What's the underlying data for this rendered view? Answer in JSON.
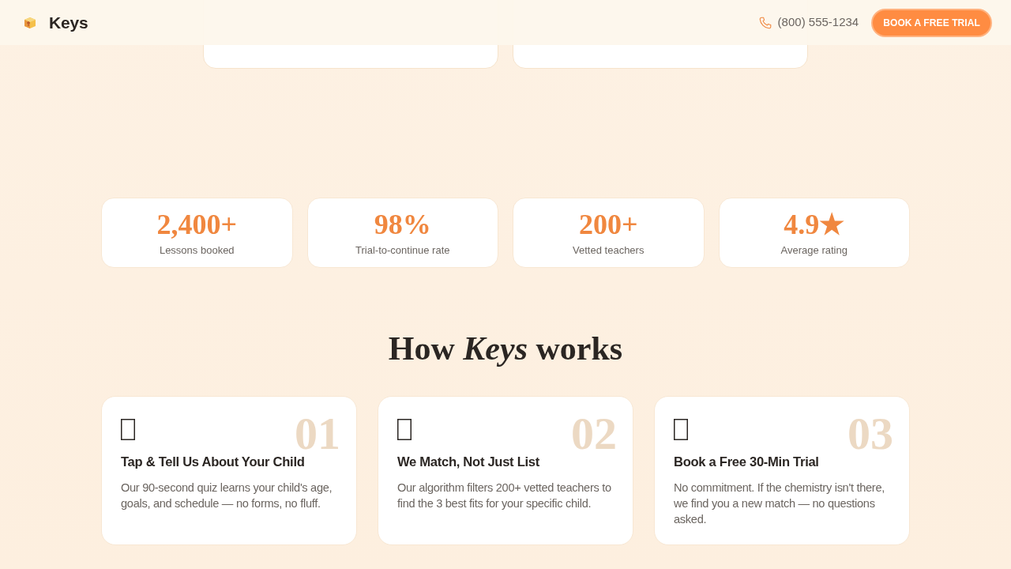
{
  "header": {
    "brand": "Keys",
    "phone": "(800) 555-1234",
    "cta": "BOOK A FREE TRIAL"
  },
  "previous_section": {
    "cards": [
      {
        "kind": "cut-off-card"
      },
      {
        "kind": "cut-off-card"
      }
    ]
  },
  "stats": [
    {
      "value": "2,400+",
      "label": "Lessons booked"
    },
    {
      "value": "98%",
      "label": "Trial-to-continue rate"
    },
    {
      "value": "200+",
      "label": "Vetted teachers"
    },
    {
      "value": "4.9★",
      "label": "Average rating"
    }
  ],
  "how_it_works": {
    "title": "How *Keys* works",
    "steps": [
      {
        "number": "01",
        "title": "Tap & Tell Us About Your Child",
        "description": "Our 90-second quiz learns your child's age, goals, and schedule — no forms, no fluff."
      },
      {
        "number": "02",
        "title": "We Match, Not Just List",
        "description": "Our algorithm filters 200+ vetted teachers to find the 3 best fits for your specific child."
      },
      {
        "number": "03",
        "title": "Book a Free 30-Min Trial",
        "description": "No commitment. If the chemistry isn't there, we find you a new match — no questions asked."
      }
    ]
  }
}
